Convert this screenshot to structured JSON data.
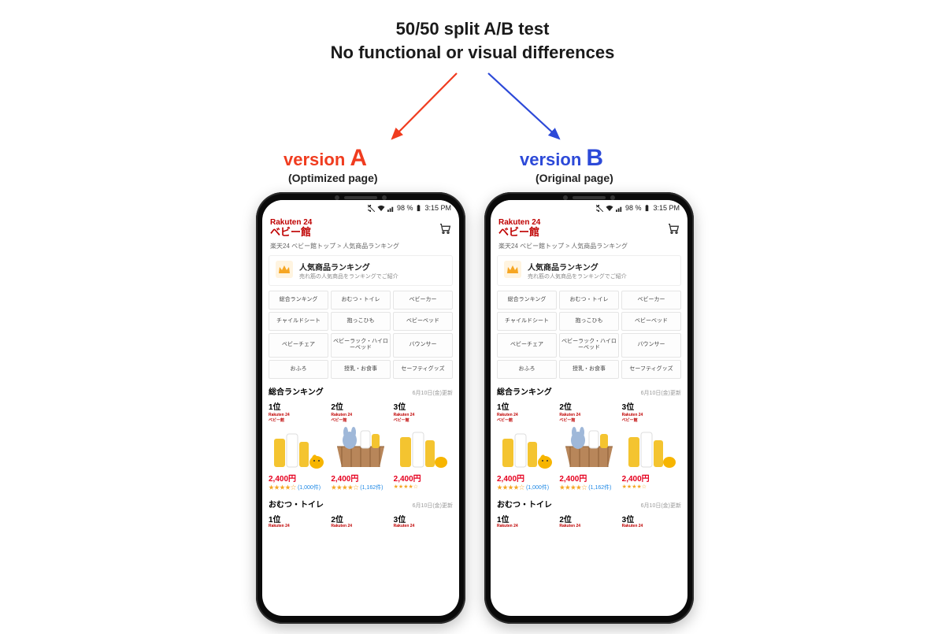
{
  "headline": {
    "line1": "50/50 split A/B test",
    "line2": "No functional or visual differences"
  },
  "versions": {
    "a": {
      "label_prefix": "version ",
      "letter": "A",
      "subtitle": "(Optimized page)"
    },
    "b": {
      "label_prefix": "version ",
      "letter": "B",
      "subtitle": "(Original page)"
    }
  },
  "colors": {
    "a": "#f03c1f",
    "b": "#2c49d8",
    "brand": "#bf0000",
    "price": "#e6001f"
  },
  "statusbar": {
    "battery_pct": "98 %",
    "time": "3:15 PM"
  },
  "header": {
    "brand_top": "Rakuten 24",
    "brand_bot": "ベビー館"
  },
  "breadcrumb": "楽天24 ベビー館トップ > 人気商品ランキング",
  "ranking_header": {
    "title": "人気商品ランキング",
    "subtitle": "売れ筋の人気商品をランキングでご紹介"
  },
  "categories": [
    "総合ランキング",
    "おむつ・トイレ",
    "ベビーカー",
    "チャイルドシート",
    "抱っこひも",
    "ベビーベッド",
    "ベビーチェア",
    "ベビーラック・ハイローベッド",
    "バウンサー",
    "おふろ",
    "授乳・お食事",
    "セーフティグッズ"
  ],
  "section1": {
    "title": "総合ランキング",
    "date": "6月10日(金)更新",
    "products": [
      {
        "rank": "1位",
        "brand_top": "Rakuten 24",
        "brand_bot": "ベビー館",
        "price": "2,400円",
        "stars": "★★★★☆",
        "count": "(1,000件)"
      },
      {
        "rank": "2位",
        "brand_top": "Rakuten 24",
        "brand_bot": "ベビー館",
        "price": "2,400円",
        "stars": "★★★★☆",
        "count": "(1,162件)"
      },
      {
        "rank": "3位",
        "brand_top": "Rakuten 24",
        "brand_bot": "ベビー館",
        "price": "2,400円",
        "stars": "★★★★☆",
        "count": ""
      }
    ]
  },
  "section2": {
    "title": "おむつ・トイレ",
    "date": "6月10日(金)更新",
    "ranks": [
      "1位",
      "2位",
      "3位"
    ],
    "brand_top": "Rakuten 24"
  }
}
